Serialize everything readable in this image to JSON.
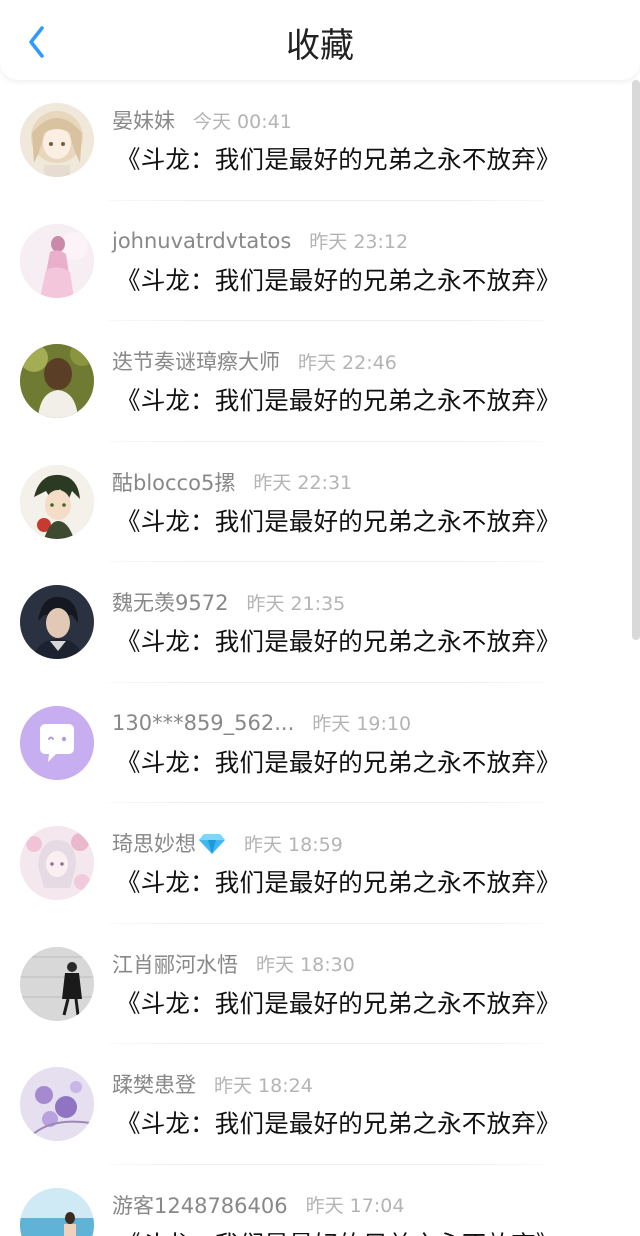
{
  "header": {
    "title": "收藏",
    "back_icon": "chevron-left-icon",
    "accent_color": "#2f9bff"
  },
  "favorites": {
    "items": [
      {
        "username": "晏妹妹",
        "time": "今天 00:41",
        "text": "《斗龙：我们是最好的兄弟之永不放弃》",
        "avatar": "anime-girl-avatar"
      },
      {
        "username": "johnuvatrdvtatos",
        "time": "昨天 23:12",
        "text": "《斗龙：我们是最好的兄弟之永不放弃》",
        "avatar": "pink-figure-avatar"
      },
      {
        "username": "迭节奏谜璋瘵大师",
        "time": "昨天 22:46",
        "text": "《斗龙：我们是最好的兄弟之永不放弃》",
        "avatar": "girl-back-avatar"
      },
      {
        "username": "酤blocco5摞",
        "time": "昨天 22:31",
        "text": "《斗龙：我们是最好的兄弟之永不放弃》",
        "avatar": "anime-boy-avatar"
      },
      {
        "username": "魏无羡9572",
        "time": "昨天 21:35",
        "text": "《斗龙：我们是最好的兄弟之永不放弃》",
        "avatar": "dark-portrait-avatar"
      },
      {
        "username": "130***859_562...",
        "time": "昨天 19:10",
        "text": "《斗龙：我们是最好的兄弟之永不放弃》",
        "avatar": "default-chat-avatar"
      },
      {
        "username": "琦思妙想",
        "time": "昨天 18:59",
        "text": "《斗龙：我们是最好的兄弟之永不放弃》",
        "avatar": "floral-girl-avatar",
        "badge": "diamond-icon"
      },
      {
        "username": "江肖郦河水悟",
        "time": "昨天 18:30",
        "text": "《斗龙：我们是最好的兄弟之永不放弃》",
        "avatar": "bw-figure-avatar"
      },
      {
        "username": "蹂樊患登",
        "time": "昨天 18:24",
        "text": "《斗龙：我们是最好的兄弟之永不放弃》",
        "avatar": "purple-flower-avatar"
      },
      {
        "username": "游客1248786406",
        "time": "昨天 17:04",
        "text": "《斗龙：我们是最好的兄弟之永不放弃》",
        "avatar": "beach-avatar"
      }
    ]
  }
}
